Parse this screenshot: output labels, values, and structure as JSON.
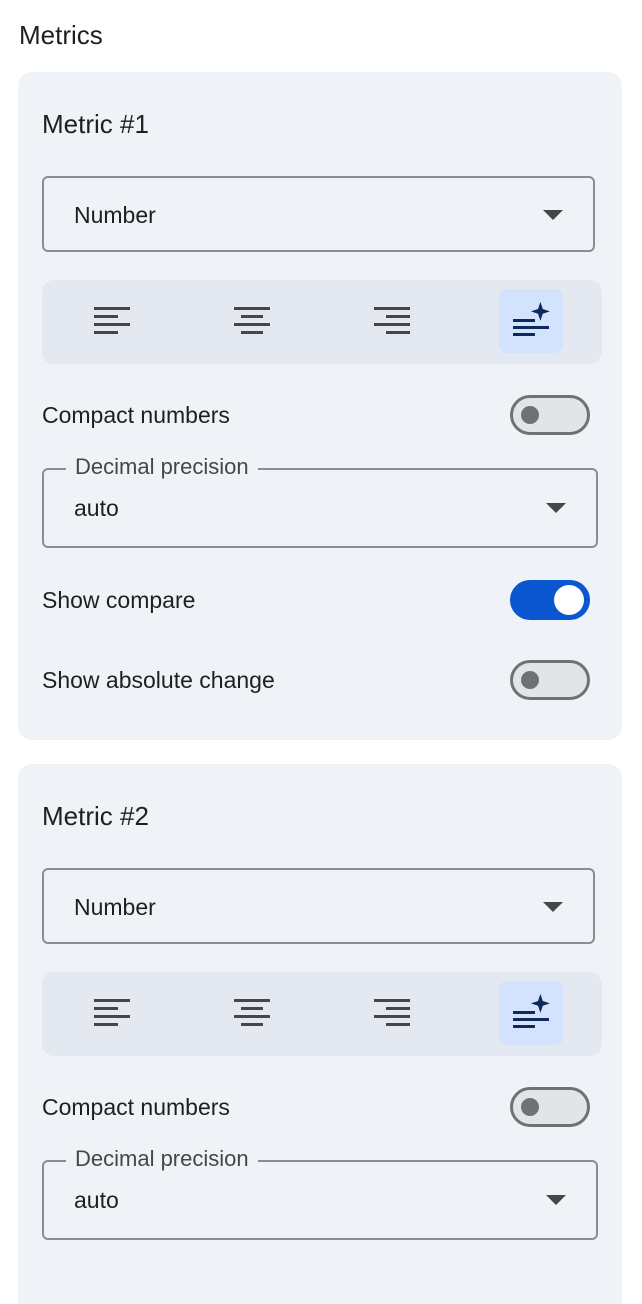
{
  "section": {
    "title": "Metrics"
  },
  "metrics": [
    {
      "title": "Metric #1",
      "format": "Number",
      "alignment": {
        "options": [
          "align-left",
          "align-center",
          "align-right",
          "align-auto"
        ],
        "selected": "align-auto"
      },
      "compact_numbers": {
        "label": "Compact numbers",
        "on": false
      },
      "decimal_precision": {
        "label": "Decimal precision",
        "value": "auto"
      },
      "show_compare": {
        "label": "Show compare",
        "on": true
      },
      "show_absolute_change": {
        "label": "Show absolute change",
        "on": false
      }
    },
    {
      "title": "Metric #2",
      "format": "Number",
      "alignment": {
        "options": [
          "align-left",
          "align-center",
          "align-right",
          "align-auto"
        ],
        "selected": "align-auto"
      },
      "compact_numbers": {
        "label": "Compact numbers",
        "on": false
      },
      "decimal_precision": {
        "label": "Decimal precision",
        "value": "auto"
      }
    }
  ],
  "colors": {
    "accent": "#0b57d0",
    "card_bg": "#eff2f7",
    "selected_bg": "#d3e3fd",
    "text": "#1f1f1f"
  }
}
